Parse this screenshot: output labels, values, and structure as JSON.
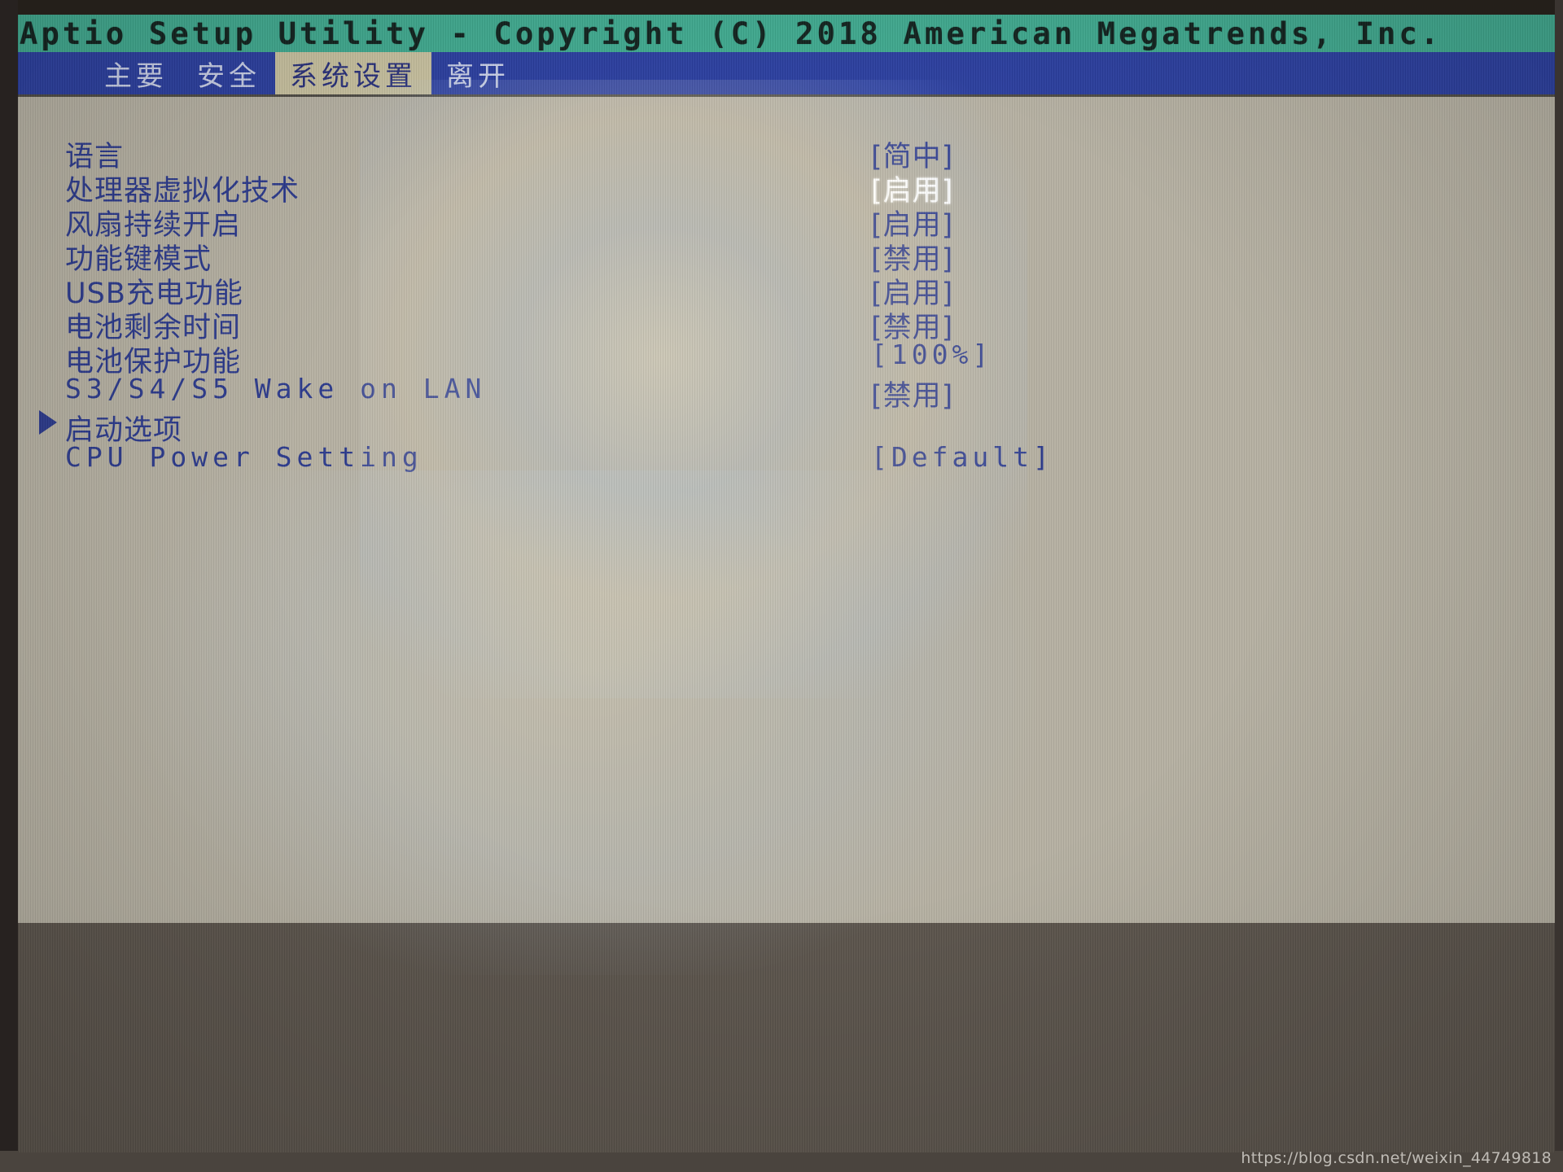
{
  "title_bar": {
    "text": "Aptio Setup Utility - Copyright (C) 2018 American Megatrends, Inc."
  },
  "tabs": [
    {
      "label": "主要",
      "active": false
    },
    {
      "label": "安全",
      "active": false
    },
    {
      "label": "系统设置",
      "active": true
    },
    {
      "label": "离开",
      "active": false
    }
  ],
  "settings": [
    {
      "label": "语言",
      "value": "[简中]",
      "mono_label": false,
      "mono_value": false,
      "highlighted": false,
      "submenu": false
    },
    {
      "label": "处理器虚拟化技术",
      "value": "[启用]",
      "mono_label": false,
      "mono_value": false,
      "highlighted": true,
      "submenu": false
    },
    {
      "label": "风扇持续开启",
      "value": "[启用]",
      "mono_label": false,
      "mono_value": false,
      "highlighted": false,
      "submenu": false
    },
    {
      "label": "功能键模式",
      "value": "[禁用]",
      "mono_label": false,
      "mono_value": false,
      "highlighted": false,
      "submenu": false
    },
    {
      "label": "USB充电功能",
      "value": "[启用]",
      "mono_label": false,
      "mono_value": false,
      "highlighted": false,
      "submenu": false
    },
    {
      "label": "电池剩余时间",
      "value": "[禁用]",
      "mono_label": false,
      "mono_value": false,
      "highlighted": false,
      "submenu": false
    },
    {
      "label": "电池保护功能",
      "value": "[100%]",
      "mono_label": false,
      "mono_value": true,
      "highlighted": false,
      "submenu": false
    },
    {
      "label": "S3/S4/S5 Wake on LAN",
      "value": "[禁用]",
      "mono_label": true,
      "mono_value": false,
      "highlighted": false,
      "submenu": false
    },
    {
      "label": "启动选项",
      "value": "",
      "mono_label": false,
      "mono_value": false,
      "highlighted": false,
      "submenu": true
    },
    {
      "label": "CPU Power Setting",
      "value": "[Default]",
      "mono_label": true,
      "mono_value": true,
      "highlighted": false,
      "submenu": false
    }
  ],
  "watermark": {
    "text": "https://blog.csdn.net/weixin_44749818"
  },
  "colors": {
    "title_bar_bg": "#3fa88e",
    "tab_bar_bg": "#2b3e9e",
    "active_tab_bg": "#c6bf9e",
    "panel_bg": "#b5b0a2",
    "text_blue": "#2c3a8c",
    "highlight_white": "#ffffff"
  }
}
